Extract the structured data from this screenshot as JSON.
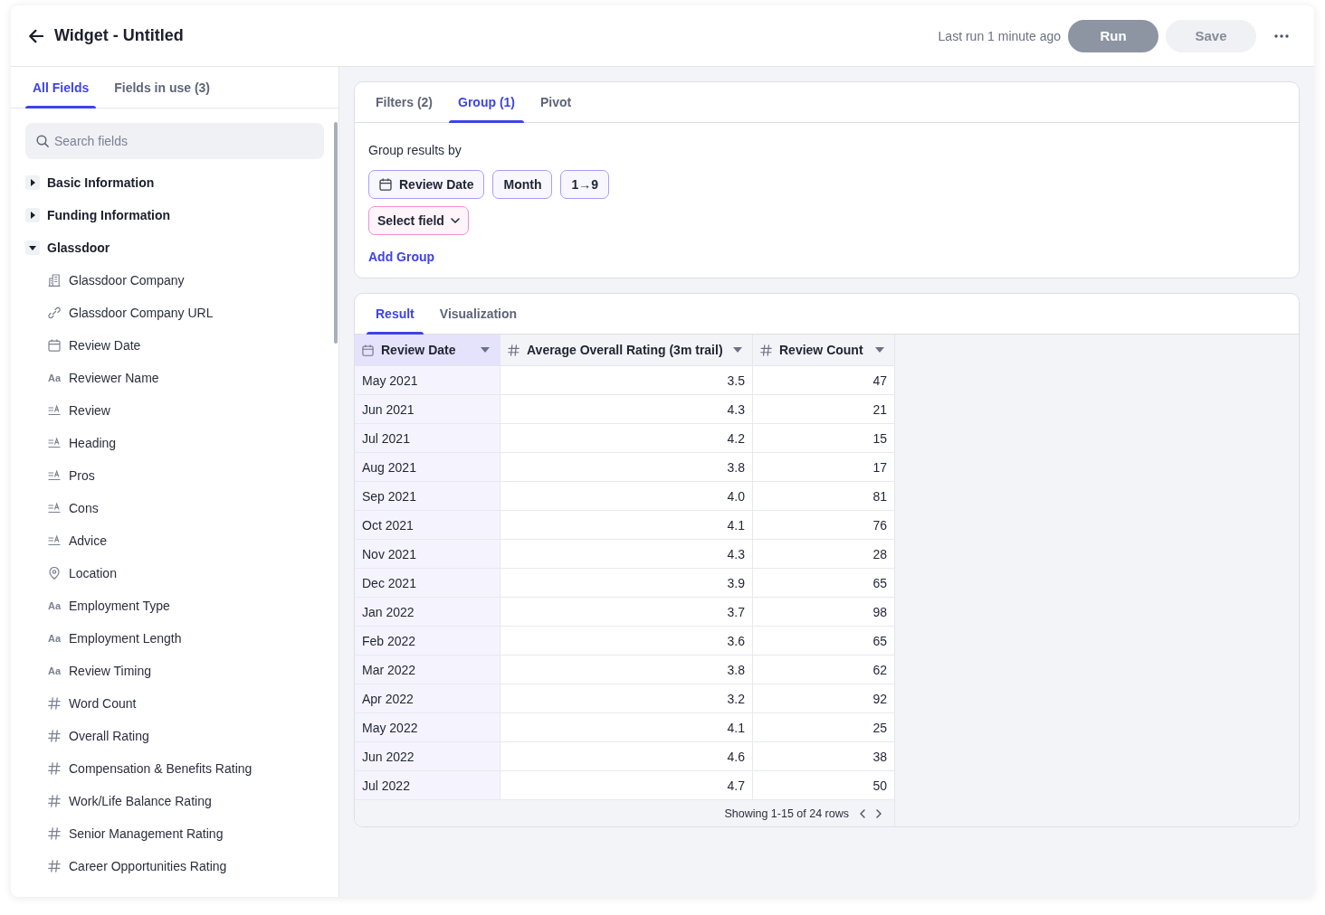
{
  "header": {
    "title": "Widget - Untitled",
    "last_run": "Last run 1 minute ago",
    "buttons": [
      {
        "label": "Run",
        "kind": "primary",
        "disabled": true
      },
      {
        "label": "Save",
        "kind": "secondary",
        "disabled": true
      }
    ]
  },
  "sidebar": {
    "tabs": [
      {
        "label": "All Fields",
        "selected": true
      },
      {
        "label": "Fields in use (3)",
        "selected": false
      }
    ],
    "search": {
      "placeholder": "Search fields"
    },
    "groups": [
      {
        "label": "Basic Information",
        "expanded": false
      },
      {
        "label": "Funding Information",
        "expanded": false
      },
      {
        "label": "Glassdoor",
        "expanded": true,
        "children": [
          {
            "label": "Glassdoor Company",
            "kind": "company"
          },
          {
            "label": "Glassdoor Company URL",
            "kind": "url"
          },
          {
            "label": "Review Date",
            "kind": "date"
          },
          {
            "label": "Reviewer Name",
            "kind": "text",
            "icon": "Aa"
          },
          {
            "label": "Review",
            "kind": "longtext"
          },
          {
            "label": "Heading",
            "kind": "longtext"
          },
          {
            "label": "Pros",
            "kind": "longtext"
          },
          {
            "label": "Cons",
            "kind": "longtext"
          },
          {
            "label": "Advice",
            "kind": "longtext"
          },
          {
            "label": "Location",
            "kind": "location"
          },
          {
            "label": "Employment Type",
            "kind": "text",
            "icon": "Aa"
          },
          {
            "label": "Employment Length",
            "kind": "text",
            "icon": "Aa"
          },
          {
            "label": "Review Timing",
            "kind": "text",
            "icon": "Aa"
          },
          {
            "label": "Word Count",
            "kind": "number"
          },
          {
            "label": "Overall Rating",
            "kind": "number"
          },
          {
            "label": "Compensation & Benefits Rating",
            "kind": "number"
          },
          {
            "label": "Work/Life Balance Rating",
            "kind": "number"
          },
          {
            "label": "Senior Management Rating",
            "kind": "number"
          },
          {
            "label": "Career Opportunities Rating",
            "kind": "number"
          }
        ]
      }
    ]
  },
  "query_panel": {
    "tabs": [
      {
        "label": "Filters (2)",
        "selected": false
      },
      {
        "label": "Group (1)",
        "selected": true
      },
      {
        "label": "Pivot",
        "selected": false
      }
    ],
    "heading": "Group results by",
    "chips": [
      {
        "label": "Review Date",
        "kind": "date"
      },
      {
        "label": "Month",
        "kind": "option"
      },
      {
        "label": "1→9",
        "kind": "option"
      }
    ],
    "select": {
      "label": "Select field"
    },
    "add_group": "Add Group"
  },
  "result_panel": {
    "tabs": [
      {
        "label": "Result",
        "selected": true
      },
      {
        "label": "Visualization",
        "selected": false
      }
    ],
    "table": {
      "columns": [
        {
          "label": "Review Date",
          "kind": "date",
          "grouped": true
        },
        {
          "label": "Average Overall Rating (3m trail)",
          "kind": "number",
          "grouped": false
        },
        {
          "label": "Review Count",
          "kind": "number",
          "grouped": false
        }
      ],
      "rows": [
        [
          "May 2021",
          "3.5",
          "47"
        ],
        [
          "Jun 2021",
          "4.3",
          "21"
        ],
        [
          "Jul 2021",
          "4.2",
          "15"
        ],
        [
          "Aug 2021",
          "3.8",
          "17"
        ],
        [
          "Sep 2021",
          "4.0",
          "81"
        ],
        [
          "Oct 2021",
          "4.1",
          "76"
        ],
        [
          "Nov 2021",
          "4.3",
          "28"
        ],
        [
          "Dec 2021",
          "3.9",
          "65"
        ],
        [
          "Jan 2022",
          "3.7",
          "98"
        ],
        [
          "Feb 2022",
          "3.6",
          "65"
        ],
        [
          "Mar 2022",
          "3.8",
          "62"
        ],
        [
          "Apr 2022",
          "3.2",
          "92"
        ],
        [
          "May 2022",
          "4.1",
          "25"
        ],
        [
          "Jun 2022",
          "4.6",
          "38"
        ],
        [
          "Jul 2022",
          "4.7",
          "50"
        ]
      ]
    },
    "pagination": "Showing 1-15 of 24 rows"
  }
}
